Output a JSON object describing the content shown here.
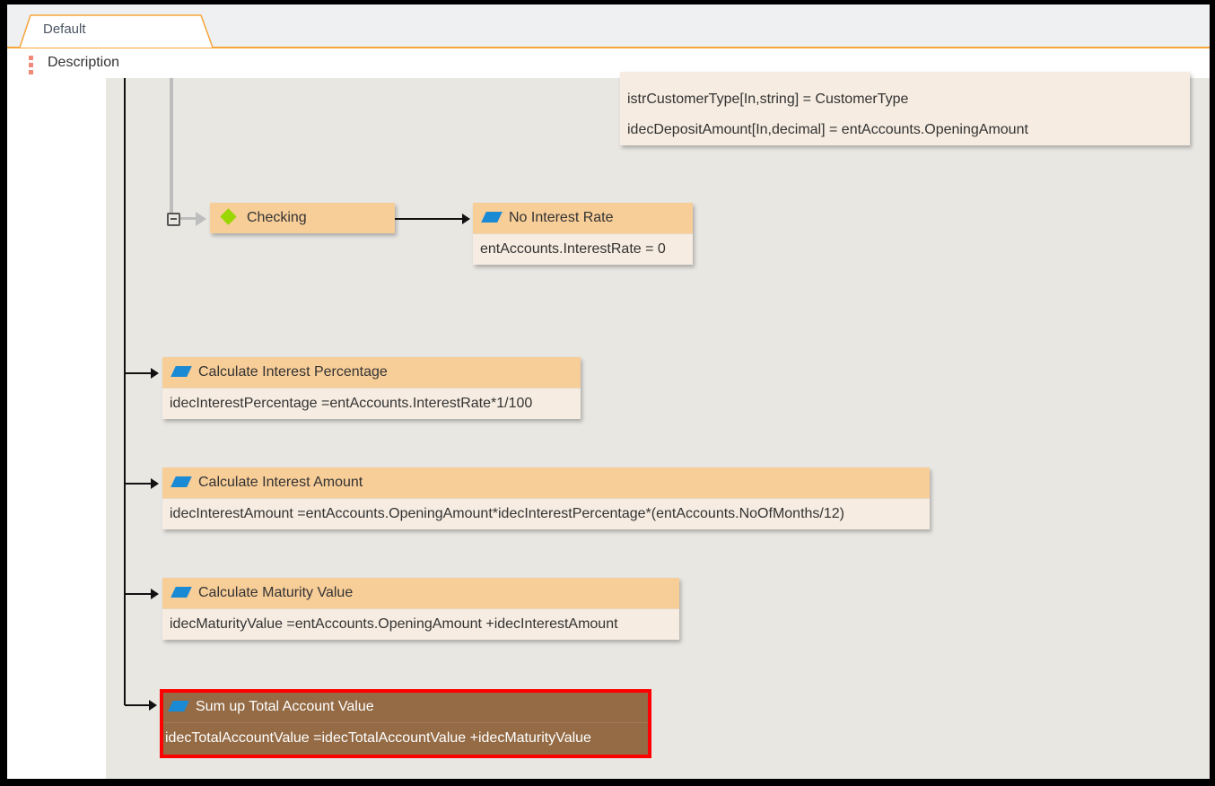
{
  "tabs": [
    {
      "label": "Default",
      "active": true
    }
  ],
  "panel": {
    "title": "Description"
  },
  "params": {
    "line2": "istrCustomerType[In,string]  =   CustomerType",
    "line3": "idecDepositAmount[In,decimal]  =   entAccounts.OpeningAmount"
  },
  "nodes": {
    "checking": {
      "title": "Checking"
    },
    "no_interest": {
      "title": "No Interest Rate",
      "expr": "entAccounts.InterestRate = 0"
    },
    "calc_pct": {
      "title": "Calculate Interest Percentage",
      "expr": "idecInterestPercentage =entAccounts.InterestRate*1/100"
    },
    "calc_amt": {
      "title": "Calculate Interest Amount",
      "expr": "idecInterestAmount =entAccounts.OpeningAmount*idecInterestPercentage*(entAccounts.NoOfMonths/12)"
    },
    "calc_mat": {
      "title": "Calculate Maturity Value",
      "expr": "idecMaturityValue =entAccounts.OpeningAmount +idecInterestAmount"
    },
    "sum_total": {
      "title": "Sum up Total Account Value",
      "expr": "idecTotalAccountValue =idecTotalAccountValue +idecMaturityValue"
    }
  },
  "colors": {
    "node_header": "#f7cd98",
    "node_body": "#f6ece1",
    "highlight": "#946b45",
    "highlight_border": "#ff0000",
    "tab_accent": "#f5a53c"
  }
}
